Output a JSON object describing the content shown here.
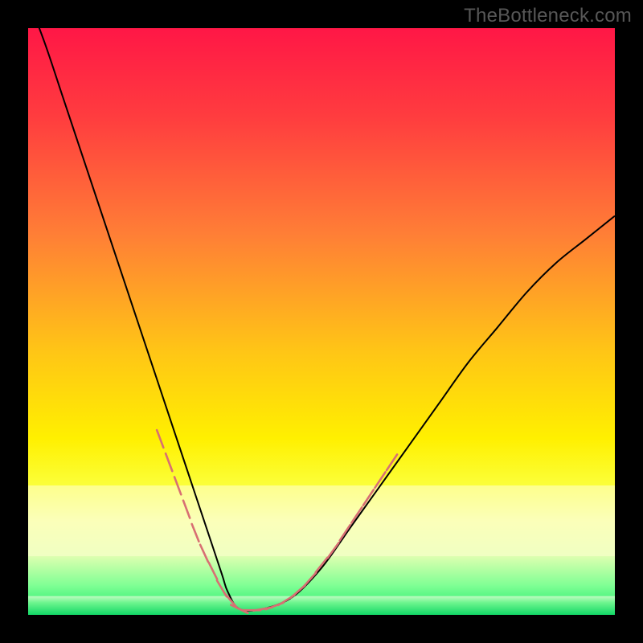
{
  "watermark": "TheBottleneck.com",
  "chart_data": {
    "type": "line",
    "title": "",
    "xlabel": "",
    "ylabel": "",
    "xlim": [
      0,
      100
    ],
    "ylim": [
      0,
      100
    ],
    "series": [
      {
        "name": "bottleneck-curve",
        "x": [
          0,
          3,
          6,
          9,
          12,
          15,
          18,
          21,
          24,
          27,
          30,
          33,
          34,
          36,
          40,
          45,
          50,
          55,
          60,
          65,
          70,
          75,
          80,
          85,
          90,
          95,
          100
        ],
        "y": [
          105,
          97,
          88,
          79,
          70,
          61,
          52,
          43,
          34,
          25,
          16,
          7,
          4,
          1,
          1,
          3,
          8,
          15,
          22,
          29,
          36,
          43,
          49,
          55,
          60,
          64,
          68
        ]
      }
    ],
    "markers": {
      "name": "highlighted-points",
      "color": "#d86f73",
      "points": [
        {
          "x": 22.5,
          "y": 30
        },
        {
          "x": 24,
          "y": 26
        },
        {
          "x": 25.5,
          "y": 22
        },
        {
          "x": 27,
          "y": 18
        },
        {
          "x": 28.5,
          "y": 14
        },
        {
          "x": 30,
          "y": 10.5
        },
        {
          "x": 31.5,
          "y": 7.5
        },
        {
          "x": 33,
          "y": 4.5
        },
        {
          "x": 34.5,
          "y": 2.5
        },
        {
          "x": 36,
          "y": 1
        },
        {
          "x": 38,
          "y": 0.8
        },
        {
          "x": 40,
          "y": 1
        },
        {
          "x": 42,
          "y": 1.5
        },
        {
          "x": 44,
          "y": 2.5
        },
        {
          "x": 46,
          "y": 4
        },
        {
          "x": 48,
          "y": 6
        },
        {
          "x": 50,
          "y": 8.5
        },
        {
          "x": 52,
          "y": 11
        },
        {
          "x": 54,
          "y": 14
        },
        {
          "x": 56,
          "y": 17
        },
        {
          "x": 58,
          "y": 20
        },
        {
          "x": 60,
          "y": 23
        },
        {
          "x": 62,
          "y": 26
        }
      ]
    },
    "gradient_stops": [
      {
        "offset": 0.0,
        "color": "#ff1746"
      },
      {
        "offset": 0.15,
        "color": "#ff3c3f"
      },
      {
        "offset": 0.35,
        "color": "#ff7e36"
      },
      {
        "offset": 0.55,
        "color": "#ffc516"
      },
      {
        "offset": 0.7,
        "color": "#fff000"
      },
      {
        "offset": 0.78,
        "color": "#fbff3a"
      },
      {
        "offset": 0.84,
        "color": "#f6ff9c"
      },
      {
        "offset": 0.9,
        "color": "#ddffb0"
      },
      {
        "offset": 0.95,
        "color": "#7fff94"
      },
      {
        "offset": 1.0,
        "color": "#17e86a"
      }
    ],
    "light_band": {
      "top_pct": 78,
      "height_pct": 12,
      "color": "rgba(255,255,210,0.55)"
    },
    "green_band_height_pct": 3.2
  }
}
